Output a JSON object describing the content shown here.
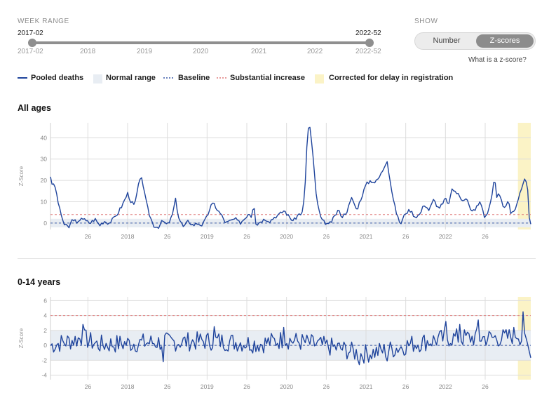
{
  "controls": {
    "week_range_title": "WEEK RANGE",
    "range_start_label": "2017-02",
    "range_end_label": "2022-52",
    "axis_start": "2017-02",
    "axis_end": "2022-52",
    "years": [
      "2018",
      "2019",
      "2020",
      "2021",
      "2022"
    ],
    "show_title": "SHOW",
    "show_options": [
      "Number",
      "Z-scores"
    ],
    "selected_option": "Z-scores",
    "help_link": "What is a z-score?"
  },
  "legend": {
    "pooled": "Pooled deaths",
    "normal": "Normal range",
    "baseline": "Baseline",
    "substantial": "Substantial increase",
    "corrected": "Corrected for delay in registration"
  },
  "colors": {
    "line": "#1f449c",
    "normal_band": "#e8edf3",
    "baseline": "#3a5aa8",
    "substantial": "#e07b7b",
    "corrected": "#fbf3c6",
    "grid": "#dcdcdc"
  },
  "chart_data": [
    {
      "type": "line",
      "title": "All ages",
      "ylabel": "Z-Score",
      "ylim": [
        -3,
        47
      ],
      "yticks": [
        0,
        10,
        20,
        30,
        40
      ],
      "xticks": [
        {
          "t": 0.16,
          "label": "26"
        },
        {
          "t": 0.33,
          "label": "2018"
        },
        {
          "t": 0.5,
          "label": "26"
        },
        {
          "t": 0.67,
          "label": "2019"
        },
        {
          "t": 0.84,
          "label": "26"
        },
        {
          "t": 1.01,
          "label": "2020"
        },
        {
          "t": 1.18,
          "label": "26"
        },
        {
          "t": 1.35,
          "label": "2021"
        },
        {
          "t": 1.52,
          "label": "26"
        },
        {
          "t": 1.69,
          "label": "2022"
        },
        {
          "t": 1.86,
          "label": "26"
        }
      ],
      "normal_range": [
        -2,
        2
      ],
      "baseline": 0,
      "substantial": 4,
      "corrected_from": 2.0,
      "series": [
        {
          "keyframes": [
            [
              0.0,
              22
            ],
            [
              0.008,
              18
            ],
            [
              0.02,
              17
            ],
            [
              0.04,
              6
            ],
            [
              0.06,
              -1
            ],
            [
              0.08,
              -2
            ],
            [
              0.09,
              1
            ],
            [
              0.1,
              2
            ],
            [
              0.115,
              -1
            ],
            [
              0.13,
              3
            ],
            [
              0.15,
              1
            ],
            [
              0.17,
              0
            ],
            [
              0.19,
              2
            ],
            [
              0.21,
              -1
            ],
            [
              0.23,
              1
            ],
            [
              0.25,
              0
            ],
            [
              0.27,
              2
            ],
            [
              0.29,
              5
            ],
            [
              0.31,
              9
            ],
            [
              0.33,
              14
            ],
            [
              0.345,
              10
            ],
            [
              0.36,
              8
            ],
            [
              0.375,
              17
            ],
            [
              0.39,
              22
            ],
            [
              0.405,
              12
            ],
            [
              0.42,
              5
            ],
            [
              0.44,
              -1
            ],
            [
              0.46,
              -2
            ],
            [
              0.48,
              1
            ],
            [
              0.5,
              -1
            ],
            [
              0.52,
              3
            ],
            [
              0.535,
              11
            ],
            [
              0.55,
              2
            ],
            [
              0.57,
              -2
            ],
            [
              0.59,
              1
            ],
            [
              0.61,
              -1
            ],
            [
              0.63,
              0
            ],
            [
              0.65,
              -1
            ],
            [
              0.67,
              3
            ],
            [
              0.685,
              8
            ],
            [
              0.7,
              9
            ],
            [
              0.715,
              6
            ],
            [
              0.73,
              4
            ],
            [
              0.75,
              0
            ],
            [
              0.77,
              1
            ],
            [
              0.79,
              2
            ],
            [
              0.81,
              0
            ],
            [
              0.83,
              2
            ],
            [
              0.85,
              5
            ],
            [
              0.86,
              3
            ],
            [
              0.87,
              10
            ],
            [
              0.88,
              -1
            ],
            [
              0.9,
              1
            ],
            [
              0.92,
              2
            ],
            [
              0.94,
              1
            ],
            [
              0.96,
              3
            ],
            [
              0.98,
              4
            ],
            [
              1.0,
              6
            ],
            [
              1.02,
              3
            ],
            [
              1.04,
              1
            ],
            [
              1.06,
              4
            ],
            [
              1.08,
              5
            ],
            [
              1.09,
              18
            ],
            [
              1.1,
              44
            ],
            [
              1.11,
              45
            ],
            [
              1.12,
              35
            ],
            [
              1.14,
              10
            ],
            [
              1.16,
              1
            ],
            [
              1.18,
              0
            ],
            [
              1.19,
              -1
            ],
            [
              1.21,
              2
            ],
            [
              1.23,
              6
            ],
            [
              1.25,
              3
            ],
            [
              1.27,
              6
            ],
            [
              1.29,
              12
            ],
            [
              1.31,
              6
            ],
            [
              1.33,
              12
            ],
            [
              1.35,
              18
            ],
            [
              1.37,
              20
            ],
            [
              1.39,
              19
            ],
            [
              1.41,
              22
            ],
            [
              1.43,
              27
            ],
            [
              1.44,
              30
            ],
            [
              1.45,
              22
            ],
            [
              1.47,
              9
            ],
            [
              1.49,
              1
            ],
            [
              1.5,
              0
            ],
            [
              1.52,
              5
            ],
            [
              1.54,
              6
            ],
            [
              1.56,
              3
            ],
            [
              1.58,
              4
            ],
            [
              1.6,
              9
            ],
            [
              1.62,
              6
            ],
            [
              1.64,
              11
            ],
            [
              1.66,
              7
            ],
            [
              1.68,
              9
            ],
            [
              1.69,
              12
            ],
            [
              1.7,
              8
            ],
            [
              1.72,
              16
            ],
            [
              1.74,
              14
            ],
            [
              1.76,
              11
            ],
            [
              1.78,
              12
            ],
            [
              1.8,
              5
            ],
            [
              1.82,
              7
            ],
            [
              1.84,
              10
            ],
            [
              1.86,
              2
            ],
            [
              1.88,
              8
            ],
            [
              1.9,
              21
            ],
            [
              1.91,
              12
            ],
            [
              1.92,
              14
            ],
            [
              1.94,
              7
            ],
            [
              1.96,
              11
            ],
            [
              1.97,
              4
            ],
            [
              1.98,
              5
            ],
            [
              1.99,
              6
            ],
            [
              2.0,
              10
            ],
            [
              2.01,
              14
            ],
            [
              2.02,
              19
            ],
            [
              2.03,
              20
            ],
            [
              2.04,
              18
            ],
            [
              2.05,
              0
            ]
          ]
        }
      ]
    },
    {
      "type": "line",
      "title": "0-14 years",
      "ylabel": "Z-Score",
      "ylim": [
        -4.6,
        6.5
      ],
      "yticks": [
        -4,
        -2,
        0,
        2,
        4,
        6
      ],
      "xticks": [
        {
          "t": 0.16,
          "label": "26"
        },
        {
          "t": 0.33,
          "label": "2018"
        },
        {
          "t": 0.5,
          "label": "26"
        },
        {
          "t": 0.67,
          "label": "2019"
        },
        {
          "t": 0.84,
          "label": "26"
        },
        {
          "t": 1.01,
          "label": "2020"
        },
        {
          "t": 1.18,
          "label": "26"
        },
        {
          "t": 1.35,
          "label": "2021"
        },
        {
          "t": 1.52,
          "label": "26"
        },
        {
          "t": 1.69,
          "label": "2022"
        },
        {
          "t": 1.86,
          "label": "26"
        }
      ],
      "normal_range": [
        -2,
        2
      ],
      "baseline": 0,
      "substantial": 4,
      "corrected_from": 2.0,
      "series": [
        {
          "seed": 7,
          "noise": [
            [
              0.0,
              0.0
            ],
            [
              0.14,
              1.0
            ],
            [
              0.2,
              0.1
            ],
            [
              0.45,
              0.4
            ],
            [
              0.7,
              0.6
            ],
            [
              0.9,
              0.2
            ],
            [
              1.0,
              0.8
            ],
            [
              1.1,
              0.3
            ],
            [
              1.25,
              -0.5
            ],
            [
              1.33,
              -1.2
            ],
            [
              1.45,
              -0.6
            ],
            [
              1.55,
              0.2
            ],
            [
              1.7,
              1.0
            ],
            [
              1.85,
              1.0
            ],
            [
              1.95,
              1.0
            ],
            [
              2.0,
              1.6
            ],
            [
              2.05,
              -0.5
            ]
          ],
          "spikes": [
            [
              0.14,
              2.8
            ],
            [
              0.48,
              -2.2
            ],
            [
              0.7,
              2.5
            ],
            [
              1.0,
              2.4
            ],
            [
              1.32,
              -2.6
            ],
            [
              1.44,
              -2.1
            ],
            [
              1.69,
              3.2
            ],
            [
              1.75,
              2.8
            ],
            [
              1.83,
              3.4
            ],
            [
              2.02,
              4.5
            ],
            [
              2.05,
              -0.8
            ]
          ]
        }
      ]
    }
  ]
}
